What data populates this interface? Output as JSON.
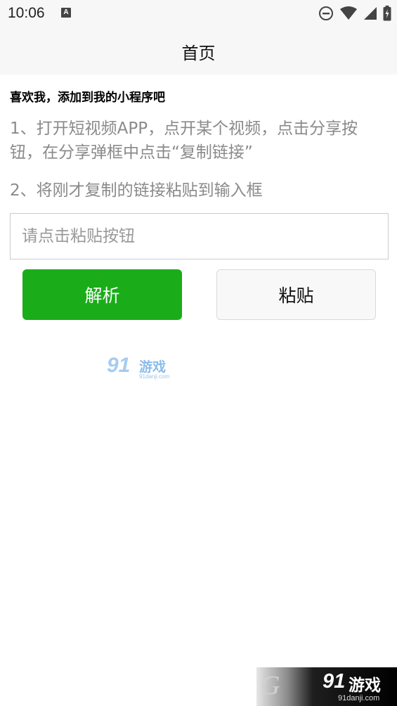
{
  "status_bar": {
    "time": "10:06",
    "notification_badge": "A",
    "icons": [
      "do-not-disturb-icon",
      "wifi-icon",
      "signal-icon",
      "battery-charging-icon"
    ]
  },
  "nav": {
    "title": "首页"
  },
  "content": {
    "intro": "喜欢我，添加到我的小程序吧",
    "step1": "1、打开短视频APP，点开某个视频，点击分享按钮，在分享弹框中点击“复制链接”",
    "step2": "2、将刚才复制的链接粘贴到输入框",
    "input": {
      "value": "",
      "placeholder": "请点击粘贴按钮"
    }
  },
  "buttons": {
    "parse_label": "解析",
    "paste_label": "粘贴"
  },
  "watermarks": {
    "center": {
      "num": "91",
      "text": "游戏",
      "url": "91danji.com"
    },
    "corner": {
      "g": "G",
      "num": "91",
      "text": "游戏",
      "url": "91danji.com"
    }
  },
  "colors": {
    "primary_green": "#1aad19",
    "muted_text": "#8a8a8a",
    "bar_bg": "#f7f7f7"
  }
}
